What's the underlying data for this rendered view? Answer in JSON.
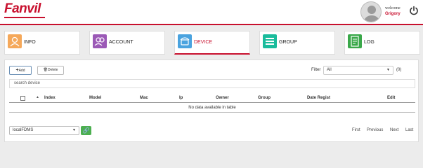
{
  "header": {
    "logo_text": "Fanvil",
    "welcome": "welcome",
    "username": "Grigory"
  },
  "nav": [
    {
      "label": "INFO",
      "color": "#f5a85a",
      "icon": "info-user-icon"
    },
    {
      "label": "ACCOUNT",
      "color": "#9b59b6",
      "icon": "account-users-icon"
    },
    {
      "label": "DEVICE",
      "color": "#4aa3df",
      "icon": "device-phone-icon",
      "active": true
    },
    {
      "label": "GROUP",
      "color": "#1abc9c",
      "icon": "group-list-icon"
    },
    {
      "label": "LOG",
      "color": "#3aa84a",
      "icon": "log-document-icon"
    }
  ],
  "toolbar": {
    "add_label": "Add",
    "delete_label": "Delete",
    "filter_label": "Filter",
    "filter_value": "All",
    "filter_count": "(0)"
  },
  "search": {
    "placeholder": "search device"
  },
  "table": {
    "columns": [
      "Index",
      "Model",
      "Mac",
      "Ip",
      "Owner",
      "Group",
      "Date Regist",
      "Edit"
    ],
    "empty_message": "No data available in table"
  },
  "footer": {
    "server_value": "localFDMS",
    "pager": [
      "First",
      "Previous",
      "Next",
      "Last"
    ]
  },
  "colors": {
    "brand": "#c8102e",
    "link_button": "#4caf50"
  }
}
